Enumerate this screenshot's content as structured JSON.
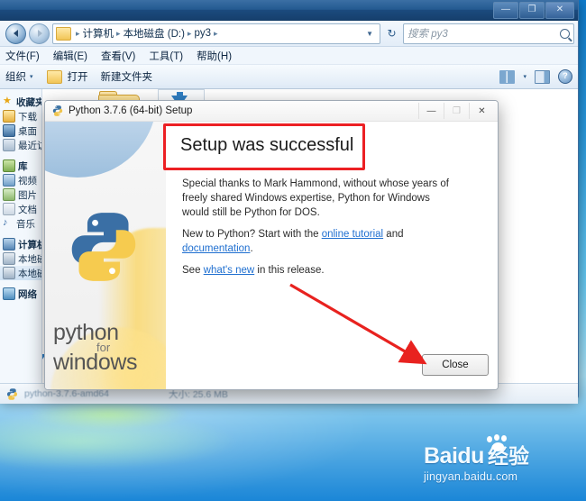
{
  "desktop": {
    "watermark": {
      "brand_latin": "Baidu",
      "brand_cn": "经验",
      "url": "jingyan.baidu.com"
    }
  },
  "explorer": {
    "titlebar": {
      "minimize_label": "—",
      "maximize_label": "❐",
      "close_label": "✕"
    },
    "address": {
      "crumbs": [
        "计算机",
        "本地磁盘 (D:)",
        "py3"
      ],
      "separator": "▸",
      "dropdown_caret": "▼",
      "refresh_label": "↻"
    },
    "search": {
      "placeholder": "搜索 py3"
    },
    "menu": [
      "文件(F)",
      "编辑(E)",
      "查看(V)",
      "工具(T)",
      "帮助(H)"
    ],
    "toolbar": {
      "organize_label": "组织",
      "organize_caret": "▾",
      "open_label": "打开",
      "newfolder_label": "新建文件夹",
      "view_caret": "▾"
    },
    "nav": {
      "groups": [
        {
          "head": "收藏夹",
          "items": [
            "下载",
            "桌面",
            "最近访问"
          ]
        },
        {
          "head": "库",
          "items": [
            "视频",
            "图片",
            "文档",
            "音乐"
          ]
        },
        {
          "head": "计算机",
          "items": [
            "本地磁盘",
            "本地磁盘"
          ]
        },
        {
          "head": "网络",
          "items": []
        }
      ]
    },
    "status": {
      "left": "python-3.7.6-amd64",
      "right": "大小: 25.6 MB"
    }
  },
  "dialog": {
    "title": "Python 3.7.6 (64-bit) Setup",
    "buttons": {
      "minimize": "—",
      "maximize": "❐",
      "close": "✕"
    },
    "heading": "Setup was successful",
    "sidebar": {
      "line1": "python",
      "line2": "for",
      "line3": "windows"
    },
    "paragraph1": "Special thanks to Mark Hammond, without whose years of freely shared Windows expertise, Python for Windows would still be Python for DOS.",
    "paragraph2_pre": "New to Python? Start with the ",
    "paragraph2_link1": "online tutorial",
    "paragraph2_mid": " and ",
    "paragraph2_link2": "documentation",
    "paragraph2_post": ".",
    "paragraph3_pre": "See ",
    "paragraph3_link": "what's new",
    "paragraph3_post": " in this release.",
    "close_button": "Close"
  },
  "annotations": {
    "highlight_color": "#ec2024",
    "arrow_color": "#e8221f"
  }
}
